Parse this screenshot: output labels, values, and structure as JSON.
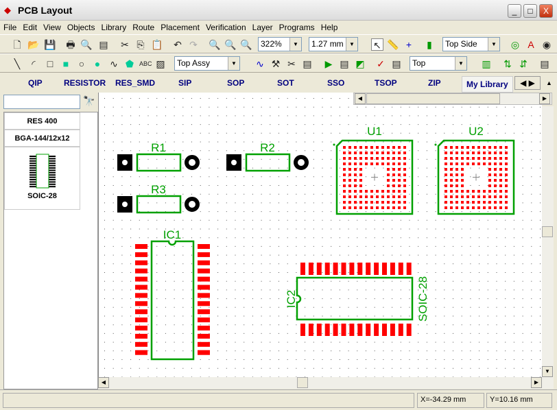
{
  "window": {
    "title": "PCB Layout",
    "minimize": "_",
    "maximize": "□",
    "close": "X"
  },
  "menu": [
    "File",
    "Edit",
    "View",
    "Objects",
    "Library",
    "Route",
    "Placement",
    "Verification",
    "Layer",
    "Programs",
    "Help"
  ],
  "toolbar1": {
    "zoom": "322%",
    "grid": "1.27 mm",
    "side": "Top Side"
  },
  "toolbar2": {
    "layer_set": "Top Assy",
    "route_layer": "Top"
  },
  "library_tabs": [
    "QIP",
    "RESISTOR",
    "RES_SMD",
    "SIP",
    "SOP",
    "SOT",
    "SSO",
    "TSOP",
    "ZIP",
    "My Library"
  ],
  "active_tab": "My Library",
  "sidebar": {
    "search_value": "",
    "items": [
      "RES 400",
      "BGA-144/12x12",
      "SOIC-28"
    ]
  },
  "canvas": {
    "labels": {
      "r1": "R1",
      "r2": "R2",
      "r3": "R3",
      "u1": "U1",
      "u2": "U2",
      "ic1": "IC1",
      "ic2": "IC2",
      "soic": "SOIC-28"
    }
  },
  "colors": {
    "silkscreen": "#00a000",
    "pad": "#ff0000",
    "through_hole": "#000000"
  },
  "status": {
    "x": "X=-34.29 mm",
    "y": "Y=10.16 mm"
  }
}
